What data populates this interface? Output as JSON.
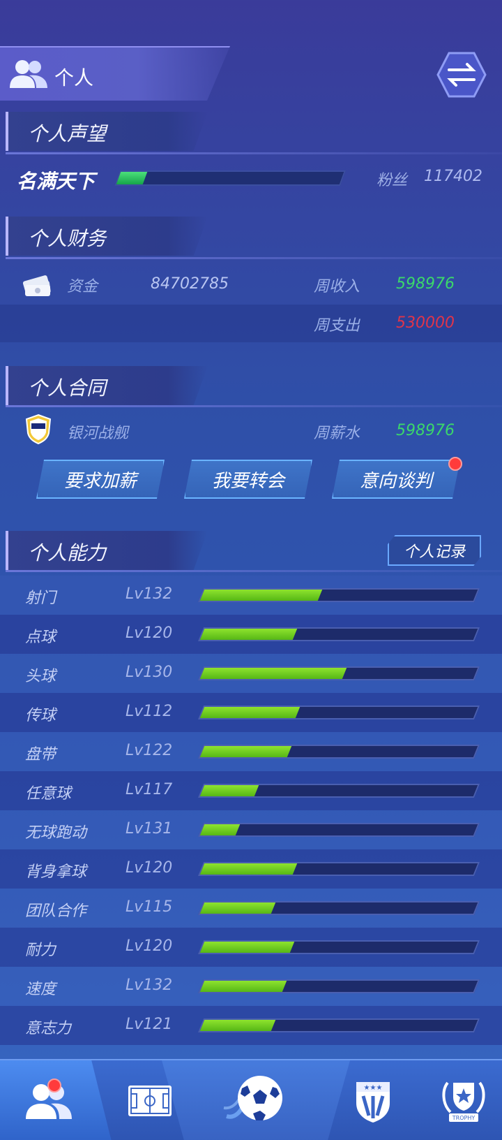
{
  "header": {
    "title": "个人"
  },
  "reputation": {
    "section_title": "个人声望",
    "level_name": "名满天下",
    "progress": 0.12,
    "fans_label": "粉丝",
    "fans_value": "117402"
  },
  "finance": {
    "section_title": "个人财务",
    "funds_label": "资金",
    "funds_value": "84702785",
    "weekly_income_label": "周收入",
    "weekly_income_value": "598976",
    "weekly_expense_label": "周支出",
    "weekly_expense_value": "530000"
  },
  "contract": {
    "section_title": "个人合同",
    "club_name": "银河战舰",
    "weekly_salary_label": "周薪水",
    "weekly_salary_value": "598976",
    "buttons": [
      "要求加薪",
      "我要转会",
      "意向谈判"
    ]
  },
  "abilities": {
    "section_title": "个人能力",
    "record_button": "个人记录",
    "items": [
      {
        "name": "射门",
        "level": "Lv132",
        "progress": 0.43
      },
      {
        "name": "点球",
        "level": "Lv120",
        "progress": 0.34
      },
      {
        "name": "头球",
        "level": "Lv130",
        "progress": 0.52
      },
      {
        "name": "传球",
        "level": "Lv112",
        "progress": 0.35
      },
      {
        "name": "盘带",
        "level": "Lv122",
        "progress": 0.32
      },
      {
        "name": "任意球",
        "level": "Lv117",
        "progress": 0.2
      },
      {
        "name": "无球跑动",
        "level": "Lv131",
        "progress": 0.13
      },
      {
        "name": "背身拿球",
        "level": "Lv120",
        "progress": 0.34
      },
      {
        "name": "团队合作",
        "level": "Lv115",
        "progress": 0.26
      },
      {
        "name": "耐力",
        "level": "Lv120",
        "progress": 0.33
      },
      {
        "name": "速度",
        "level": "Lv132",
        "progress": 0.3
      },
      {
        "name": "意志力",
        "level": "Lv121",
        "progress": 0.26
      }
    ]
  },
  "colors": {
    "green": "#3bd86a",
    "red": "#e0344a",
    "bar_green": "#7bd426",
    "notification_red": "#ff3b3b"
  },
  "bottom_nav": [
    "players-icon",
    "pitch-icon",
    "football-icon",
    "club-badge-icon",
    "trophy-icon"
  ]
}
